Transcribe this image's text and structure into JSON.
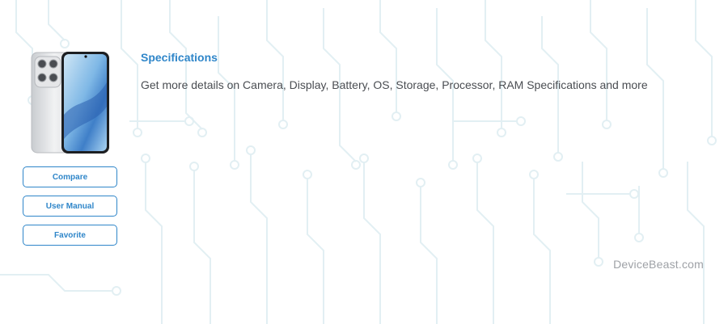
{
  "device": {
    "image_alt": "Phone with quad camera module and blue wallpaper"
  },
  "actions": {
    "compare_label": "Compare",
    "user_manual_label": "User Manual",
    "favorite_label": "Favorite"
  },
  "specifications": {
    "title": "Specifications",
    "description": "Get more details on Camera, Display, Battery, OS, Storage, Processor, RAM Specifications and more"
  },
  "branding": {
    "watermark": "DeviceBeast.com"
  },
  "colors": {
    "accent": "#2f86c9",
    "body_text": "#4a4d52",
    "muted_text": "#9ea1a6",
    "pattern": "#e4f1f5"
  }
}
